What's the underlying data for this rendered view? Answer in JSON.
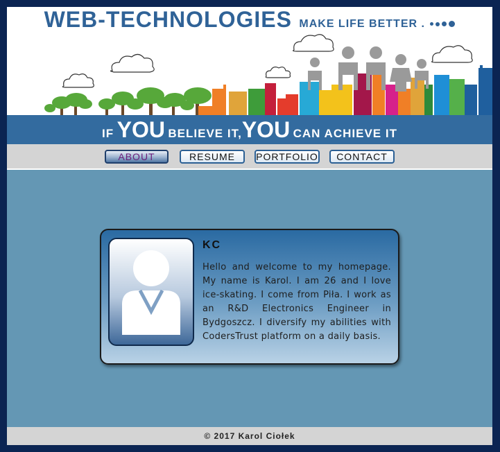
{
  "header": {
    "title": "WEB-TECHNOLOGIES",
    "tagline": "MAKE LIFE BETTER ."
  },
  "banner": {
    "part1": "IF",
    "part2": "YOU",
    "part3": "BELIEVE IT,",
    "part4": "YOU",
    "part5": "CAN ACHIEVE IT"
  },
  "nav": {
    "items": [
      {
        "label": "ABOUT",
        "active": true
      },
      {
        "label": "RESUME",
        "active": false
      },
      {
        "label": "PORTFOLIO",
        "active": false
      },
      {
        "label": "CONTACT",
        "active": false
      }
    ]
  },
  "profile": {
    "name": "KC",
    "bio": "Hello and welcome to my homepage. My name is Karol. I am 26 and I love ice-skating. I come from Piła. I work as an R&D Electronics Engineer in Bydgoszcz. I diversify my abilities with CodersTrust platform on a daily basis.",
    "avatar_icon": "user-silhouette-icon"
  },
  "footer": {
    "copyright": "© 2017 Karol Ciołek"
  },
  "colors": {
    "page_background": "#0b2452",
    "content_background": "#6497b4",
    "brand_blue": "#2f6297",
    "banner_blue": "#336b9f",
    "nav_background": "#d4d4d4",
    "active_nav_text": "#6b1d7a"
  }
}
